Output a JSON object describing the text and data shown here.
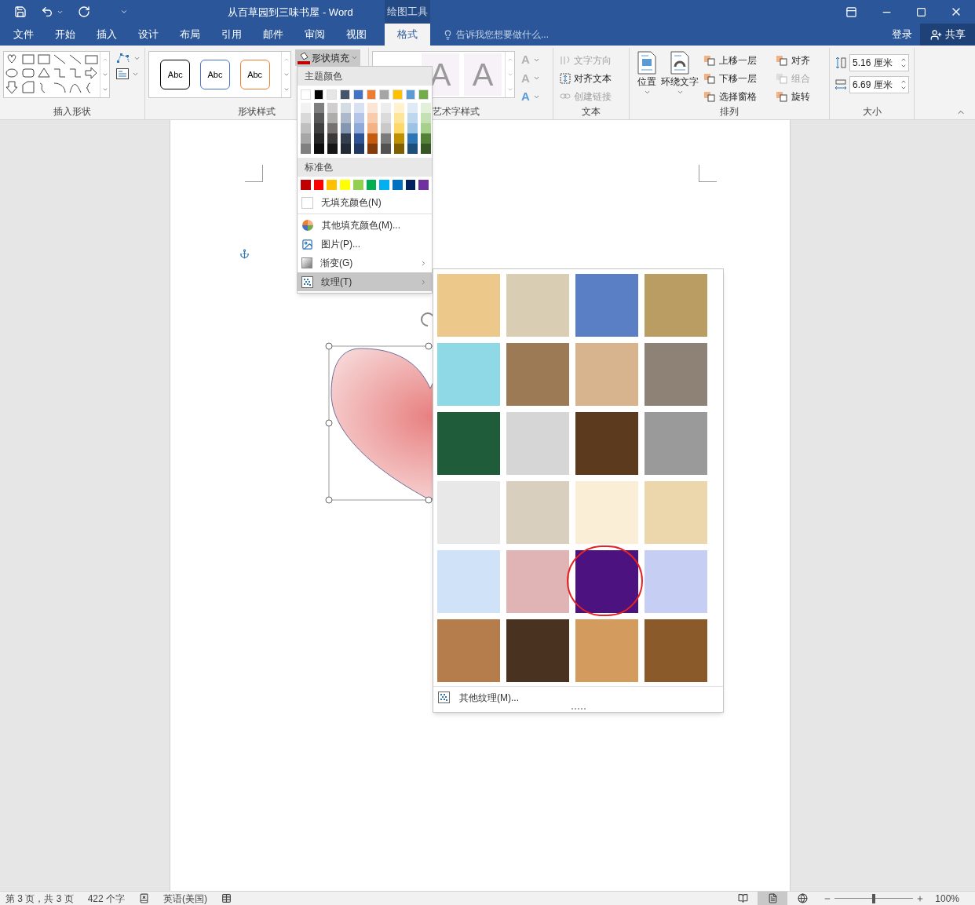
{
  "title_bar": {
    "title": "从百草园到三味书屋 - Word",
    "contextual_tab": "绘图工具"
  },
  "tabs": [
    {
      "label": "文件",
      "selected": false
    },
    {
      "label": "开始",
      "selected": false
    },
    {
      "label": "插入",
      "selected": false
    },
    {
      "label": "设计",
      "selected": false
    },
    {
      "label": "布局",
      "selected": false
    },
    {
      "label": "引用",
      "selected": false
    },
    {
      "label": "邮件",
      "selected": false
    },
    {
      "label": "审阅",
      "selected": false
    },
    {
      "label": "视图",
      "selected": false
    },
    {
      "label": "格式",
      "selected": true
    }
  ],
  "tell_me": {
    "placeholder": "告诉我您想要做什么..."
  },
  "sign_in": "登录",
  "share": "共享",
  "ribbon": {
    "insert_shapes": {
      "label": "插入形状"
    },
    "shape_styles": {
      "label": "形状样式",
      "samples": [
        {
          "text": "Abc",
          "color": "#000000"
        },
        {
          "text": "Abc",
          "color": "#4472c4"
        },
        {
          "text": "Abc",
          "color": "#ed7d31"
        }
      ],
      "fill_button": "形状填充"
    },
    "wordart_styles": {
      "label": "艺术字样式",
      "samples": [
        "A",
        "A"
      ],
      "buttons": [
        "A",
        "A",
        "A"
      ]
    },
    "text": {
      "label": "文本",
      "items": [
        {
          "label": "文字方向",
          "disabled": true
        },
        {
          "label": "对齐文本",
          "disabled": false
        },
        {
          "label": "创建链接",
          "disabled": true
        }
      ]
    },
    "arrange": {
      "label": "排列",
      "large": [
        "位置",
        "环绕文字"
      ],
      "items": [
        {
          "label": "上移一层",
          "disabled": false
        },
        {
          "label": "对齐",
          "disabled": false
        },
        {
          "label": "下移一层",
          "disabled": false
        },
        {
          "label": "组合",
          "disabled": true
        },
        {
          "label": "选择窗格",
          "disabled": false
        },
        {
          "label": "旋转",
          "disabled": false
        }
      ]
    },
    "size": {
      "label": "大小",
      "height": "5.16 厘米",
      "width": "6.69 厘米"
    }
  },
  "fill_menu": {
    "theme_header": "主题颜色",
    "theme_colors": [
      {
        "color": "#ffffff",
        "shades": [
          {
            "color": "#f2f2f2"
          },
          {
            "color": "#d9d9d9"
          },
          {
            "color": "#bfbfbf"
          },
          {
            "color": "#a6a6a6"
          },
          {
            "color": "#808080"
          }
        ]
      },
      {
        "color": "#000000",
        "shades": [
          {
            "color": "#7f7f7f"
          },
          {
            "color": "#595959"
          },
          {
            "color": "#404040"
          },
          {
            "color": "#262626"
          },
          {
            "color": "#0d0d0d"
          }
        ]
      },
      {
        "color": "#e7e6e6",
        "shades": [
          {
            "color": "#d0cece"
          },
          {
            "color": "#aeabab"
          },
          {
            "color": "#757171"
          },
          {
            "color": "#3a3838"
          },
          {
            "color": "#171616"
          }
        ]
      },
      {
        "color": "#44546a",
        "shades": [
          {
            "color": "#d6dce4"
          },
          {
            "color": "#adb9ca"
          },
          {
            "color": "#8497b0"
          },
          {
            "color": "#333f4f"
          },
          {
            "color": "#222a35"
          }
        ]
      },
      {
        "color": "#4472c4",
        "shades": [
          {
            "color": "#d9e2f3"
          },
          {
            "color": "#b4c6e7"
          },
          {
            "color": "#8eaadb"
          },
          {
            "color": "#2f5496"
          },
          {
            "color": "#1f3864"
          }
        ]
      },
      {
        "color": "#ed7d31",
        "shades": [
          {
            "color": "#fbe5d5"
          },
          {
            "color": "#f7cbac"
          },
          {
            "color": "#f4b183"
          },
          {
            "color": "#c55a11"
          },
          {
            "color": "#843c0b"
          }
        ]
      },
      {
        "color": "#a5a5a5",
        "shades": [
          {
            "color": "#ededed"
          },
          {
            "color": "#dbdbdb"
          },
          {
            "color": "#c9c9c9"
          },
          {
            "color": "#7b7b7b"
          },
          {
            "color": "#525252"
          }
        ]
      },
      {
        "color": "#ffc000",
        "shades": [
          {
            "color": "#fff2cc"
          },
          {
            "color": "#ffe598"
          },
          {
            "color": "#ffd966"
          },
          {
            "color": "#bf9000"
          },
          {
            "color": "#7f6000"
          }
        ]
      },
      {
        "color": "#5b9bd5",
        "shades": [
          {
            "color": "#deebf6"
          },
          {
            "color": "#bdd7ee"
          },
          {
            "color": "#9cc3e5"
          },
          {
            "color": "#2e75b5"
          },
          {
            "color": "#1e4e79"
          }
        ]
      },
      {
        "color": "#70ad47",
        "shades": [
          {
            "color": "#e2efd9"
          },
          {
            "color": "#c5e0b3"
          },
          {
            "color": "#a8d08d"
          },
          {
            "color": "#538135"
          },
          {
            "color": "#375623"
          }
        ]
      }
    ],
    "standard_header": "标准色",
    "standard_colors": [
      {
        "color": "#c00000"
      },
      {
        "color": "#ff0000"
      },
      {
        "color": "#ffc000"
      },
      {
        "color": "#ffff00"
      },
      {
        "color": "#92d050"
      },
      {
        "color": "#00b050"
      },
      {
        "color": "#00b0f0"
      },
      {
        "color": "#0070c0"
      },
      {
        "color": "#002060"
      },
      {
        "color": "#7030a0"
      }
    ],
    "items": [
      {
        "kind": "no_fill",
        "label": "无填充颜色(N)",
        "selected": false
      },
      {
        "kind": "more_colors",
        "label": "其他填充颜色(M)...",
        "selected": false
      },
      {
        "kind": "picture",
        "label": "图片(P)...",
        "selected": false
      },
      {
        "kind": "gradient",
        "label": "渐变(G)",
        "selected": false
      },
      {
        "kind": "texture",
        "label": "纹理(T)",
        "selected": true
      }
    ]
  },
  "texture_gallery": {
    "textures": [
      {
        "color": "#ecc98a",
        "selected": false
      },
      {
        "color": "#d9cdb4",
        "selected": false
      },
      {
        "color": "#5a7fc4",
        "selected": false
      },
      {
        "color": "#b99d62",
        "selected": false
      },
      {
        "color": "#8fd8e6",
        "selected": false
      },
      {
        "color": "#9c7a55",
        "selected": false
      },
      {
        "color": "#d7b48e",
        "selected": false
      },
      {
        "color": "#8e8277",
        "selected": false
      },
      {
        "color": "#1f5c3a",
        "selected": false
      },
      {
        "color": "#d6d6d6",
        "selected": false
      },
      {
        "color": "#5c3a1e",
        "selected": false
      },
      {
        "color": "#9a9a9a",
        "selected": false
      },
      {
        "color": "#e8e8e8",
        "selected": false
      },
      {
        "color": "#d8cfbf",
        "selected": false
      },
      {
        "color": "#fbeed6",
        "selected": false
      },
      {
        "color": "#ecd7ac",
        "selected": false
      },
      {
        "color": "#cfe2f7",
        "selected": false
      },
      {
        "color": "#e0b4b4",
        "selected": false
      },
      {
        "color": "#4b1280",
        "selected": true
      },
      {
        "color": "#c6cff3",
        "selected": false
      },
      {
        "color": "#b57c4c",
        "selected": false
      },
      {
        "color": "#4a3220",
        "selected": false
      },
      {
        "color": "#d49b5e",
        "selected": false
      },
      {
        "color": "#8b5a2b",
        "selected": false
      }
    ],
    "more": "其他纹理(M)..."
  },
  "status_bar": {
    "page": "第 3 页，共 3 页",
    "words": "422 个字",
    "language": "英语(美国)",
    "views": [
      {
        "kind": "read",
        "selected": false
      },
      {
        "kind": "print",
        "selected": true
      },
      {
        "kind": "web",
        "selected": false
      }
    ],
    "zoom": {
      "level": 0.5,
      "reading": "100%"
    }
  }
}
